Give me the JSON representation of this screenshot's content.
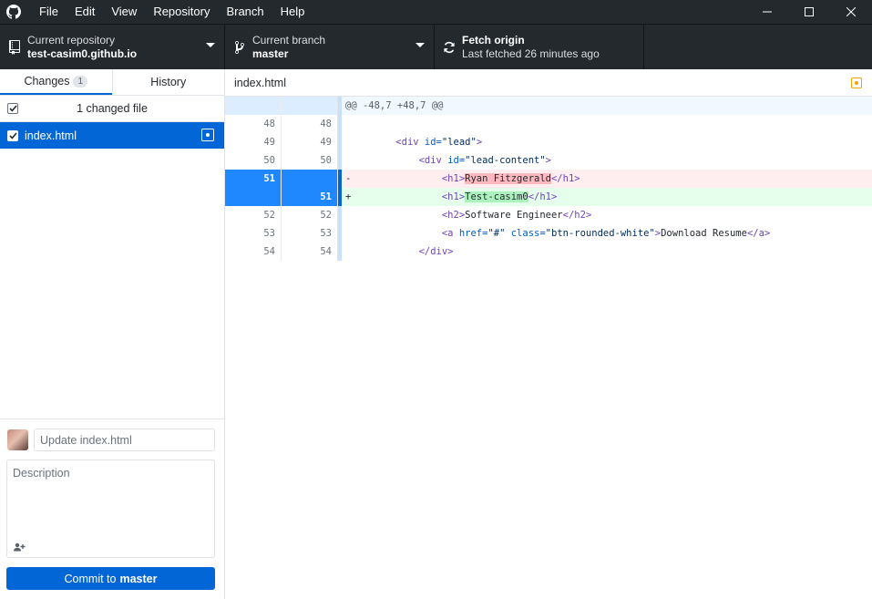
{
  "menu": [
    "File",
    "Edit",
    "View",
    "Repository",
    "Branch",
    "Help"
  ],
  "toolbar": {
    "repo_label": "Current repository",
    "repo_value": "test-casim0.github.io",
    "branch_label": "Current branch",
    "branch_value": "master",
    "fetch_label": "Fetch origin",
    "fetch_value": "Last fetched 26 minutes ago"
  },
  "sidebar": {
    "tab_changes": "Changes",
    "changes_count": "1",
    "tab_history": "History",
    "changed_files_label": "1 changed file",
    "files": [
      {
        "name": "index.html",
        "status": "modified"
      }
    ]
  },
  "commit": {
    "summary_placeholder": "Update index.html",
    "description_placeholder": "Description",
    "button_prefix": "Commit to",
    "button_branch": "master"
  },
  "diff": {
    "file_name": "index.html",
    "hunk_header": "@@ -48,7 +48,7 @@",
    "lines": [
      {
        "old": "48",
        "new": "48",
        "type": "ctx",
        "indent": "",
        "parts": []
      },
      {
        "old": "49",
        "new": "49",
        "type": "ctx",
        "indent": "    ",
        "parts": [
          [
            "tag",
            "<div "
          ],
          [
            "attr",
            "id="
          ],
          [
            "str",
            "\"lead\""
          ],
          [
            "tag",
            ">"
          ]
        ]
      },
      {
        "old": "50",
        "new": "50",
        "type": "ctx",
        "indent": "        ",
        "parts": [
          [
            "tag",
            "<div "
          ],
          [
            "attr",
            "id="
          ],
          [
            "str",
            "\"lead-content\""
          ],
          [
            "tag",
            ">"
          ]
        ]
      },
      {
        "old": "51",
        "new": "",
        "type": "del",
        "indent": "            ",
        "parts": [
          [
            "tag",
            "<h1>"
          ],
          [
            "hl",
            "Ryan Fitzgerald"
          ],
          [
            "tag",
            "</h1>"
          ]
        ]
      },
      {
        "old": "",
        "new": "51",
        "type": "add",
        "indent": "            ",
        "parts": [
          [
            "tag",
            "<h1>"
          ],
          [
            "hl",
            "Test-casim0"
          ],
          [
            "tag",
            "</h1>"
          ]
        ]
      },
      {
        "old": "52",
        "new": "52",
        "type": "ctx",
        "indent": "            ",
        "parts": [
          [
            "tag",
            "<h2>"
          ],
          [
            "txt",
            "Software Engineer"
          ],
          [
            "tag",
            "</h2>"
          ]
        ]
      },
      {
        "old": "53",
        "new": "53",
        "type": "ctx",
        "indent": "            ",
        "parts": [
          [
            "tag",
            "<a "
          ],
          [
            "attr",
            "href="
          ],
          [
            "str",
            "\"#\""
          ],
          [
            "attr",
            " class="
          ],
          [
            "str",
            "\"btn-rounded-white\""
          ],
          [
            "tag",
            ">"
          ],
          [
            "txt",
            "Download Resume"
          ],
          [
            "tag",
            "</a>"
          ]
        ]
      },
      {
        "old": "54",
        "new": "54",
        "type": "ctx",
        "indent": "        ",
        "parts": [
          [
            "tag",
            "</div>"
          ]
        ]
      }
    ]
  },
  "colors": {
    "accent": "#0366d6",
    "titlebar": "#24292e",
    "deletion": "#ffeef0",
    "addition": "#e6ffed"
  }
}
